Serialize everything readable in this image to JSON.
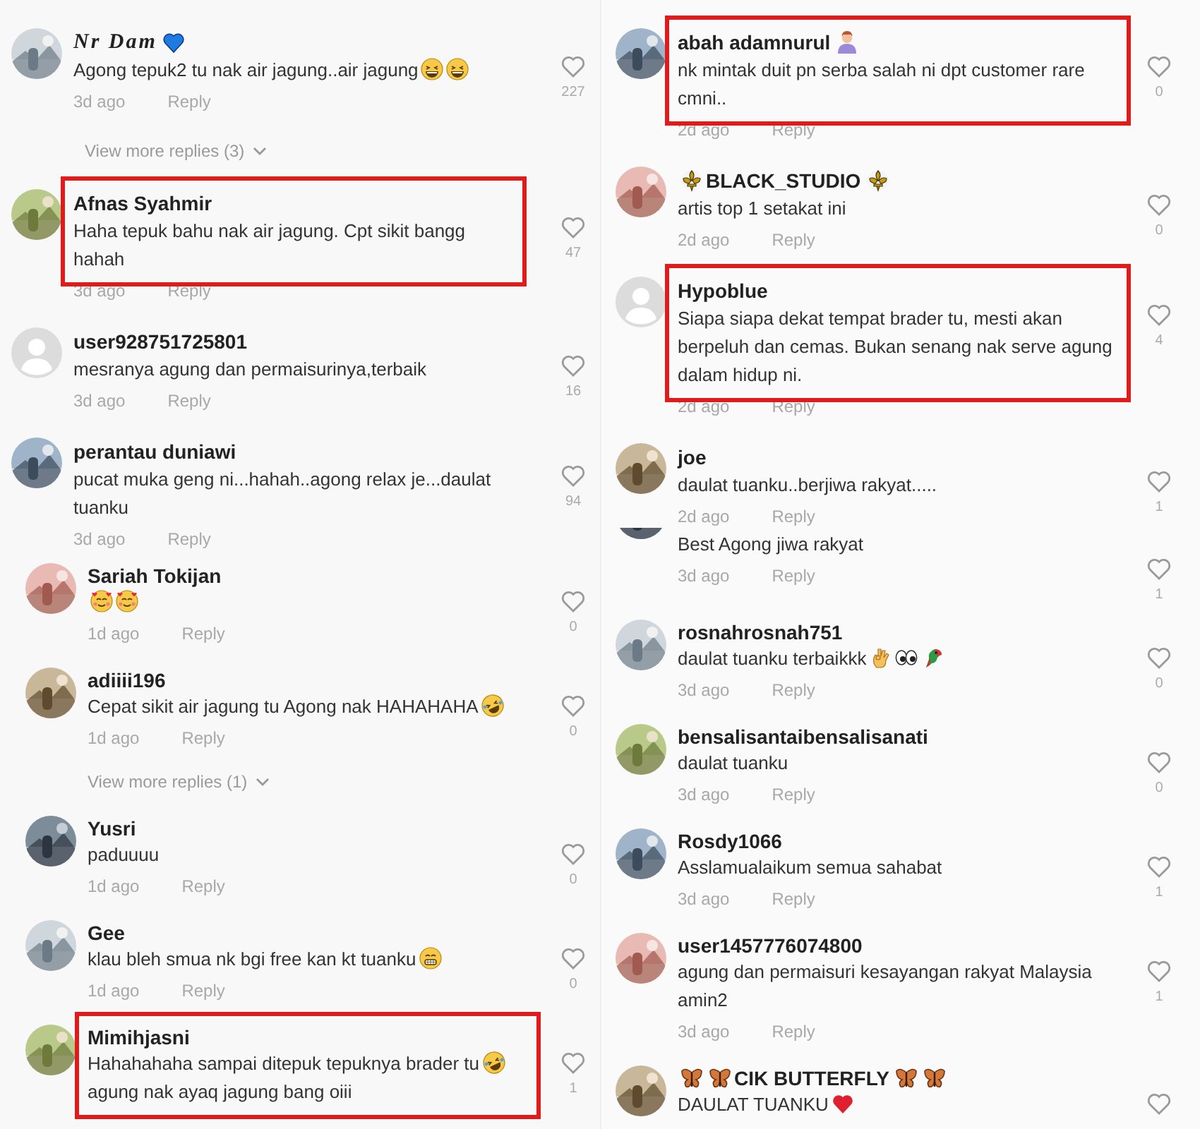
{
  "columns": [
    {
      "panels": [
        {
          "items": [
            {
              "kind": "comment",
              "default_avatar": false,
              "name": [
                {
                  "kind": "fancy",
                  "text": "Nr Dam"
                },
                {
                  "kind": "blue-heart"
                }
              ],
              "body": [
                {
                  "kind": "text",
                  "text": "Agong tepuk2 tu nak air jagung..air jagung"
                },
                {
                  "kind": "laugh"
                },
                {
                  "kind": "laugh"
                }
              ],
              "time": "3d ago",
              "reply": "Reply",
              "likes": "227",
              "highlighted": false
            },
            {
              "kind": "more",
              "label": "View more replies (3)"
            },
            {
              "kind": "comment",
              "default_avatar": false,
              "name": [
                {
                  "kind": "text",
                  "text": "Afnas Syahmir"
                }
              ],
              "body": [
                {
                  "kind": "text",
                  "text": "Haha tepuk bahu nak air jagung. Cpt sikit bangg hahah"
                }
              ],
              "time": "3d ago",
              "reply": "Reply",
              "likes": "47",
              "highlighted": true
            },
            {
              "kind": "comment",
              "default_avatar": true,
              "name": [
                {
                  "kind": "text",
                  "text": "user928751725801"
                }
              ],
              "body": [
                {
                  "kind": "text",
                  "text": "mesranya agung dan permaisurinya,terbaik"
                }
              ],
              "time": "3d ago",
              "reply": "Reply",
              "likes": "16",
              "highlighted": false
            },
            {
              "kind": "comment",
              "default_avatar": false,
              "name": [
                {
                  "kind": "text",
                  "text": "perantau duniawi"
                }
              ],
              "body": [
                {
                  "kind": "text",
                  "text": "pucat muka geng ni...hahah..agong relax je...daulat tuanku"
                }
              ],
              "time": "3d ago",
              "reply": "Reply",
              "likes": "94",
              "highlighted": false
            }
          ]
        },
        {
          "items": [
            {
              "kind": "comment",
              "default_avatar": false,
              "name": [
                {
                  "kind": "text",
                  "text": "Sariah Tokijan"
                }
              ],
              "body": [
                {
                  "kind": "hearts-face"
                },
                {
                  "kind": "hearts-face"
                }
              ],
              "time": "1d ago",
              "reply": "Reply",
              "likes": "0",
              "highlighted": false
            },
            {
              "kind": "comment",
              "default_avatar": false,
              "name": [
                {
                  "kind": "text",
                  "text": "adiiii196"
                }
              ],
              "body": [
                {
                  "kind": "text",
                  "text": "Cepat sikit air jagung tu Agong nak HAHAHAHA"
                },
                {
                  "kind": "rofl"
                }
              ],
              "time": "1d ago",
              "reply": "Reply",
              "likes": "0",
              "highlighted": false
            },
            {
              "kind": "more",
              "label": "View more replies (1)"
            },
            {
              "kind": "comment",
              "default_avatar": false,
              "name": [
                {
                  "kind": "text",
                  "text": "Yusri"
                }
              ],
              "body": [
                {
                  "kind": "text",
                  "text": "paduuuu"
                }
              ],
              "time": "1d ago",
              "reply": "Reply",
              "likes": "0",
              "highlighted": false
            },
            {
              "kind": "comment",
              "default_avatar": false,
              "name": [
                {
                  "kind": "text",
                  "text": "Gee"
                }
              ],
              "body": [
                {
                  "kind": "text",
                  "text": "klau bleh smua nk bgi free kan kt tuanku"
                },
                {
                  "kind": "grin"
                }
              ],
              "time": "1d ago",
              "reply": "Reply",
              "likes": "0",
              "highlighted": false
            },
            {
              "kind": "comment",
              "default_avatar": false,
              "name": [
                {
                  "kind": "text",
                  "text": "Mimihjasni"
                }
              ],
              "body": [
                {
                  "kind": "text",
                  "text": "Hahahahaha sampai ditepuk tepuknya brader tu"
                },
                {
                  "kind": "rofl"
                },
                {
                  "kind": "text",
                  "text": "agung nak ayaq jagung bang oiii"
                }
              ],
              "likes": "1",
              "highlighted": true
            }
          ]
        }
      ]
    },
    {
      "panels": [
        {
          "items": [
            {
              "kind": "comment",
              "default_avatar": false,
              "name": [
                {
                  "kind": "text",
                  "text": "abah adamnurul"
                },
                {
                  "kind": "person"
                }
              ],
              "body": [
                {
                  "kind": "text",
                  "text": "nk mintak duit pn serba salah ni dpt customer rare cmni.."
                }
              ],
              "time": "2d ago",
              "reply": "Reply",
              "likes": "0",
              "highlighted": true
            },
            {
              "kind": "comment",
              "default_avatar": false,
              "name": [
                {
                  "kind": "fleur"
                },
                {
                  "kind": "text",
                  "text": "BLACK_STUDIO"
                },
                {
                  "kind": "fleur"
                }
              ],
              "body": [
                {
                  "kind": "text",
                  "text": "artis top 1 setakat ini"
                }
              ],
              "time": "2d ago",
              "reply": "Reply",
              "likes": "0",
              "highlighted": false
            },
            {
              "kind": "comment",
              "default_avatar": true,
              "name": [
                {
                  "kind": "text",
                  "text": "Hypoblue"
                }
              ],
              "body": [
                {
                  "kind": "text",
                  "text": "Siapa siapa dekat tempat brader tu, mesti akan berpeluh dan cemas. Bukan senang nak serve agung dalam hidup ni."
                }
              ],
              "time": "2d ago",
              "reply": "Reply",
              "likes": "4",
              "highlighted": true
            },
            {
              "kind": "comment",
              "default_avatar": false,
              "name": [
                {
                  "kind": "text",
                  "text": "joe"
                }
              ],
              "body": [
                {
                  "kind": "text",
                  "text": "daulat tuanku..berjiwa rakyat....."
                }
              ],
              "time": "2d ago",
              "reply": "Reply",
              "likes": "1",
              "highlighted": false
            }
          ]
        },
        {
          "items": [
            {
              "kind": "comment",
              "body": [
                {
                  "kind": "text",
                  "text": "Best Agong jiwa rakyat"
                }
              ],
              "time": "3d ago",
              "reply": "Reply",
              "likes": "1",
              "highlighted": false
            },
            {
              "kind": "comment",
              "default_avatar": false,
              "name": [
                {
                  "kind": "text",
                  "text": "rosnahrosnah751"
                }
              ],
              "body": [
                {
                  "kind": "text",
                  "text": "daulat tuanku terbaikkk"
                },
                {
                  "kind": "ok-hand"
                },
                {
                  "kind": "eyes"
                },
                {
                  "kind": "parrot"
                }
              ],
              "time": "3d ago",
              "reply": "Reply",
              "likes": "0",
              "highlighted": false
            },
            {
              "kind": "comment",
              "default_avatar": false,
              "name": [
                {
                  "kind": "text",
                  "text": "bensalisantaibensalisanati"
                }
              ],
              "body": [
                {
                  "kind": "text",
                  "text": "daulat tuanku"
                }
              ],
              "time": "3d ago",
              "reply": "Reply",
              "likes": "0",
              "highlighted": false
            },
            {
              "kind": "comment",
              "default_avatar": false,
              "name": [
                {
                  "kind": "text",
                  "text": "Rosdy1066"
                }
              ],
              "body": [
                {
                  "kind": "text",
                  "text": "Asslamualaikum semua sahabat"
                }
              ],
              "time": "3d ago",
              "reply": "Reply",
              "likes": "1",
              "highlighted": false
            },
            {
              "kind": "comment",
              "default_avatar": false,
              "name": [
                {
                  "kind": "text",
                  "text": "user1457776074800"
                }
              ],
              "body": [
                {
                  "kind": "text",
                  "text": "agung dan permaisuri kesayangan rakyat Malaysia amin2"
                }
              ],
              "time": "3d ago",
              "reply": "Reply",
              "likes": "1",
              "highlighted": false
            },
            {
              "kind": "comment",
              "default_avatar": false,
              "name": [
                {
                  "kind": "butterfly"
                },
                {
                  "kind": "butterfly"
                },
                {
                  "kind": "text",
                  "text": "CIK BUTTERFLY"
                },
                {
                  "kind": "butterfly"
                },
                {
                  "kind": "butterfly"
                }
              ],
              "body": [
                {
                  "kind": "text",
                  "text": "DAULAT TUANKU"
                },
                {
                  "kind": "red-heart"
                }
              ],
              "highlighted": false
            }
          ]
        }
      ]
    }
  ]
}
